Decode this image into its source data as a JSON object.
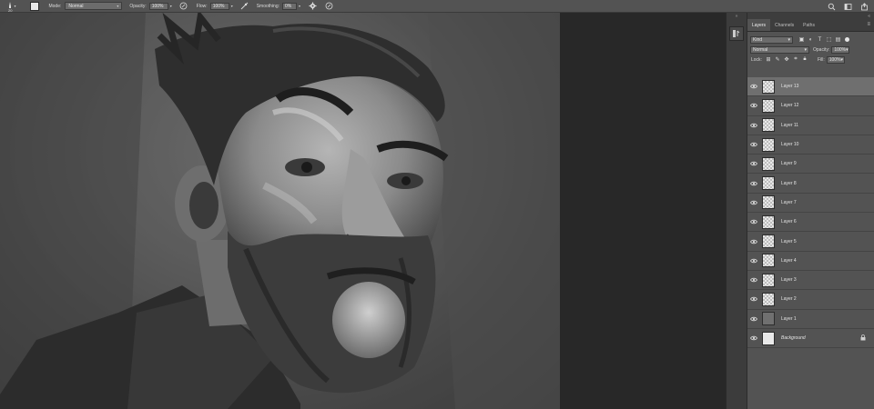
{
  "options_bar": {
    "brush_size": "20",
    "mode_label": "Mode:",
    "mode_value": "Normal",
    "opacity_label": "Opacity:",
    "opacity_value": "100%",
    "flow_label": "Flow:",
    "flow_value": "100%",
    "smoothing_label": "Smoothing:",
    "smoothing_value": "0%"
  },
  "panel": {
    "collapse_glyph": "»",
    "tabs": [
      {
        "label": "Layers",
        "active": true
      },
      {
        "label": "Channels",
        "active": false
      },
      {
        "label": "Paths",
        "active": false
      }
    ],
    "kind_label": "Kind",
    "blend_mode": "Normal",
    "opacity_label": "Opacity:",
    "opacity_value": "100%",
    "lock_label": "Lock:",
    "fill_label": "Fill:",
    "fill_value": "100%"
  },
  "layers": [
    {
      "name": "Layer 13",
      "thumb": "transparent",
      "selected": true
    },
    {
      "name": "Layer 12",
      "thumb": "transparent",
      "selected": false
    },
    {
      "name": "Layer 11",
      "thumb": "transparent",
      "selected": false
    },
    {
      "name": "Layer 10",
      "thumb": "transparent",
      "selected": false
    },
    {
      "name": "Layer 9",
      "thumb": "transparent",
      "selected": false
    },
    {
      "name": "Layer 8",
      "thumb": "transparent",
      "selected": false
    },
    {
      "name": "Layer 7",
      "thumb": "transparent",
      "selected": false
    },
    {
      "name": "Layer 6",
      "thumb": "transparent",
      "selected": false
    },
    {
      "name": "Layer 5",
      "thumb": "transparent",
      "selected": false
    },
    {
      "name": "Layer 4",
      "thumb": "transparent",
      "selected": false
    },
    {
      "name": "Layer 3",
      "thumb": "transparent",
      "selected": false
    },
    {
      "name": "Layer 2",
      "thumb": "transparent",
      "selected": false
    },
    {
      "name": "Layer 1",
      "thumb": "grey",
      "selected": false
    },
    {
      "name": "Background",
      "thumb": "white",
      "selected": false,
      "locked": true
    }
  ],
  "colors": {
    "panel_bg": "#535353",
    "toolbar_bg": "#535353",
    "pasteboard_bg": "#282828",
    "selected_layer": "#6f6f6f"
  }
}
